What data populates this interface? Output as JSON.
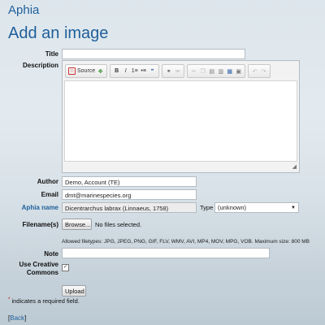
{
  "app_name": "Aphia",
  "page_title": "Add an image",
  "form": {
    "title_label": "Title",
    "title_value": "",
    "description_label": "Description",
    "editor": {
      "source_label": "Source",
      "bold": "B",
      "italic": "I",
      "numbered_list": "1≡",
      "bullet_list": "•≡",
      "blockquote": "❞"
    },
    "author_label": "Author",
    "author_value": "Demo, Account (TE)",
    "email_label": "Email",
    "email_value": "dmt@marinespecies.org",
    "aphia_name_label": "Aphia name",
    "aphia_name_value": "Dicentrarchus labrax (Linnaeus, 1758)",
    "type_label": "Type",
    "type_value": "(unknown)",
    "filenames_label": "Filename(s)",
    "browse_label": "Browse...",
    "no_files_text": "No files selected.",
    "allowed_filetypes": "Allowed filetypes: JPG, JPEG, PNG, GIF, FLV, WMV, AVI, MP4, MOV, MPG, VOB. Maximum size: 800 MB",
    "note_label": "Note",
    "note_value": "",
    "creative_commons_label_1": "Use Creative",
    "creative_commons_label_2": "Commons",
    "creative_commons_checked": true,
    "upload_label": "Upload",
    "required_star": "*",
    "required_note": "indicates a required field."
  },
  "back": {
    "open": "[",
    "label": "Back",
    "close": "]"
  }
}
